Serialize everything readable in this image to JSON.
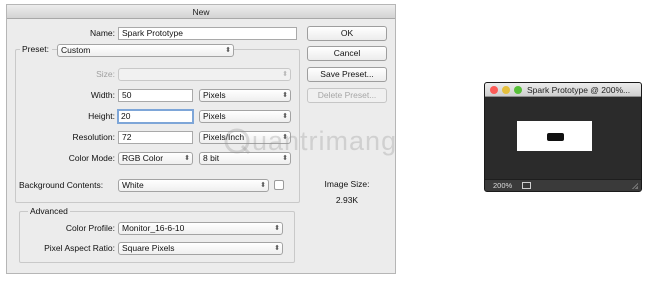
{
  "dialog": {
    "title": "New",
    "name_label": "Name:",
    "name_value": "Spark Prototype",
    "preset_label": "Preset:",
    "preset_value": "Custom",
    "size_label": "Size:",
    "size_value": "",
    "width_label": "Width:",
    "width_value": "50",
    "width_unit": "Pixels",
    "height_label": "Height:",
    "height_value": "20",
    "height_unit": "Pixels",
    "resolution_label": "Resolution:",
    "resolution_value": "72",
    "resolution_unit": "Pixels/Inch",
    "color_mode_label": "Color Mode:",
    "color_mode_value": "RGB Color",
    "bit_depth_value": "8 bit",
    "background_label": "Background Contents:",
    "background_value": "White",
    "advanced_title": "Advanced",
    "color_profile_label": "Color Profile:",
    "color_profile_value": "Monitor_16-6-10",
    "pixel_aspect_label": "Pixel Aspect Ratio:",
    "pixel_aspect_value": "Square Pixels",
    "buttons": {
      "ok": "OK",
      "cancel": "Cancel",
      "save_preset": "Save Preset...",
      "delete_preset": "Delete Preset..."
    },
    "image_size_label": "Image Size:",
    "image_size_value": "2.93K"
  },
  "preview": {
    "title": "Spark Prototype @ 200%...",
    "zoom": "200%",
    "traffic_lights": {
      "close": "#fc5b57",
      "minimize": "#e5bf3c",
      "zoom": "#57c038"
    }
  },
  "watermark": {
    "text": "uantrimang"
  }
}
